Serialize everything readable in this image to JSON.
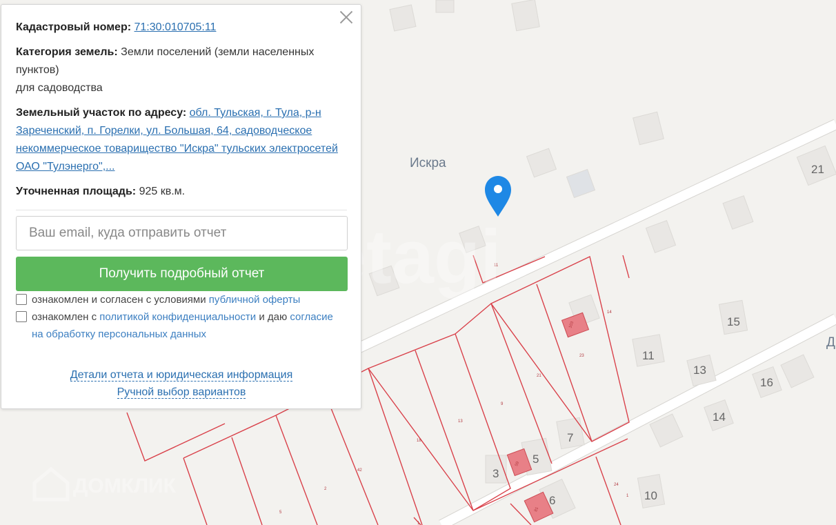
{
  "popup": {
    "cadastral_label": "Кадастровый номер:",
    "cadastral_value": "71:30:010705:11",
    "category_label": "Категория земель:",
    "category_value": "Земли поселений (земли населенных пунктов)",
    "category_use": "для садоводства",
    "address_label": "Земельный участок по адресу:",
    "address_value": "обл. Тульская, г. Тула, р-н Зареченский, п. Горелки, ул. Большая, 64, садоводческое некоммерческое товарищество \"Искра\" тульских электросетей ОАО \"Тулэнерго\",...",
    "area_label": "Уточненная площадь:",
    "area_value": "925 кв.м.",
    "email_placeholder": "Ваш email, куда отправить отчет",
    "submit_label": "Получить подробный отчет",
    "consent1_text": "ознакомлен и согласен с условиями",
    "consent1_link": "публичной оферты",
    "consent2_text": "ознакомлен с",
    "consent2_link": "политикой конфиденциальности",
    "consent2_text2": "и даю",
    "consent2_link2": "согласие на обработку персональных данных",
    "details_link": "Детали отчета и юридическая информация",
    "manual_link": "Ручной выбор вариантов"
  },
  "map": {
    "place_label": "Искра",
    "street_label_partial": "Д",
    "watermark": "etagi",
    "brand_watermark": "ДОМКЛИК",
    "marker_color": "#1e88e5",
    "house_numbers": [
      "21",
      "15",
      "11",
      "13",
      "16",
      "14",
      "7",
      "5",
      "3",
      "6",
      "10"
    ],
    "plot_numbers": [
      "11",
      "14",
      "23",
      "21",
      "9",
      "13",
      "18",
      "42",
      "2",
      "5",
      "24",
      "1",
      "1"
    ],
    "building_labels": [
      "103",
      "59",
      "81"
    ]
  }
}
